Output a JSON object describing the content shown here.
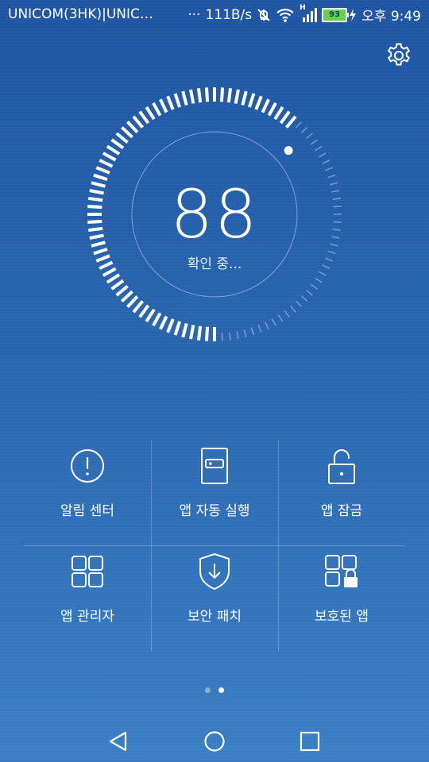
{
  "status_bar": {
    "carrier": "UNICOM(3HK)|UNIC…",
    "dots": "···",
    "speed": "111B/s",
    "network": "H",
    "battery": "93",
    "time": "오후 9:49"
  },
  "scan": {
    "score": "88",
    "status": "확인 중...",
    "progress": 0.62
  },
  "features": [
    {
      "label": "알림 센터",
      "icon": "alert-circle-icon"
    },
    {
      "label": "앱 자동 실행",
      "icon": "app-launch-icon"
    },
    {
      "label": "앱 잠금",
      "icon": "unlock-icon"
    },
    {
      "label": "앱 관리자",
      "icon": "grid-apps-icon"
    },
    {
      "label": "보안 패치",
      "icon": "shield-download-icon"
    },
    {
      "label": "보호된 앱",
      "icon": "protected-apps-icon"
    }
  ],
  "pager": {
    "pages": 2,
    "active": 2
  },
  "colors": {
    "background_top": "#1f56a3",
    "background_bottom": "#3a7fc4",
    "battery": "#62d24e"
  }
}
